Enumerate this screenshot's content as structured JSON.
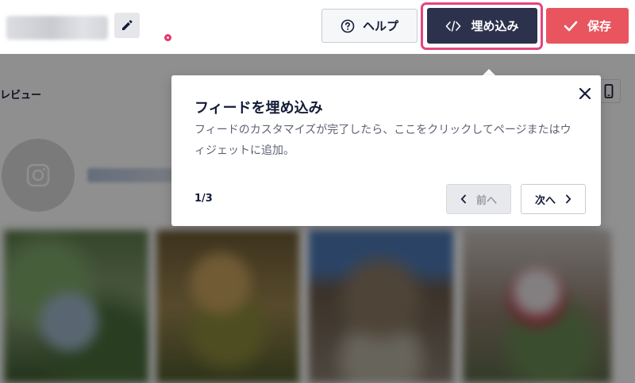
{
  "toolbar": {
    "edit_icon": "pencil-icon",
    "help": {
      "icon": "question-circle-icon",
      "label": "ヘルプ"
    },
    "embed": {
      "icon": "code-icon",
      "label": "埋め込み",
      "highlight_color": "#e6447f",
      "bg_color": "#2c324c"
    },
    "save": {
      "icon": "check-icon",
      "label": "保存",
      "bg_color": "#e8555f"
    }
  },
  "preview": {
    "label": "レビュー",
    "device_icon": "mobile-icon",
    "avatar_icon": "instagram-icon"
  },
  "popover": {
    "title": "フィードを埋め込み",
    "body": "フィードのカスタマイズが完了したら、ここをクリックしてページまたはウィジェットに追加。",
    "close_icon": "close-icon",
    "step": "1/3",
    "prev_label": "前へ",
    "next_label": "次へ"
  }
}
